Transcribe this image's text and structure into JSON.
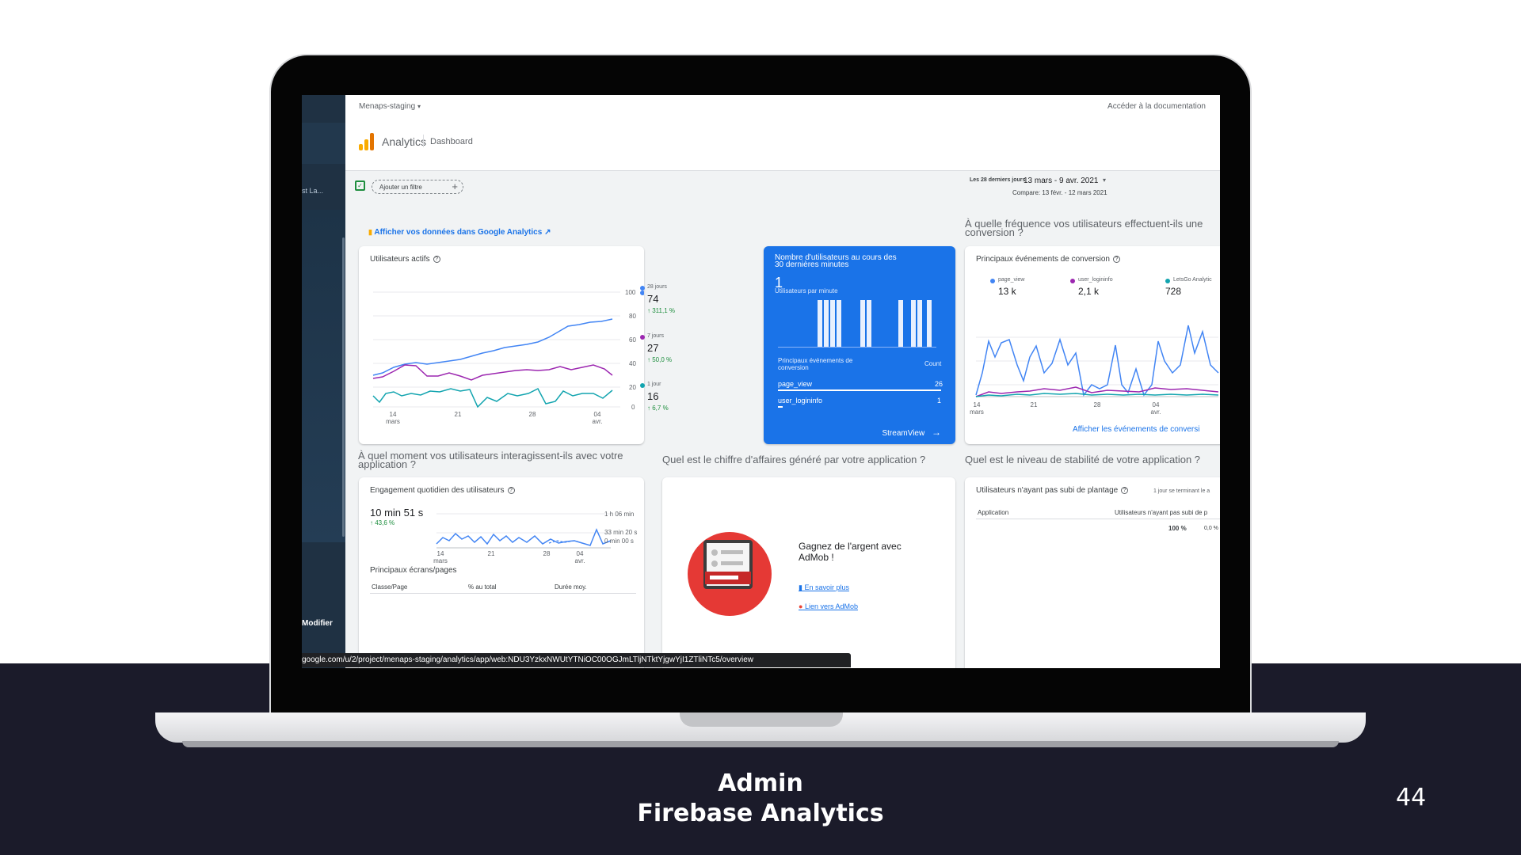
{
  "slide": {
    "title_line1": "Admin",
    "title_line2": "Firebase Analytics",
    "page_number": "44"
  },
  "colors": {
    "blue": "#4285f4",
    "purple": "#9c27b0",
    "teal": "#12a4af",
    "realtime_card": "#1a73e8",
    "footer": "#1b1b2a"
  },
  "sidebar": {
    "truncated_item": "st La...",
    "edit_label": "Modifier"
  },
  "topbar": {
    "project": "Menaps-staging",
    "project_icon": "chevron-down-icon",
    "docs_link": "Accéder à la documentation",
    "brand": "Analytics",
    "page": "Dashboard"
  },
  "filters": {
    "add_filter": "Ajouter un filtre",
    "add_icon": "plus-icon",
    "date_caption": "Les 28 derniers jours",
    "date_range": "13 mars - 9 avr. 2021",
    "compare": "Compare: 13 févr. - 12 mars 2021"
  },
  "ga_link": {
    "label": "Afficher vos données dans Google Analytics",
    "icon": "open-in-new-icon"
  },
  "questions": {
    "frequency": "À quelle fréquence vos utilisateurs effectuent-ils une conversion ?",
    "moment": "À quel moment vos utilisateurs interagissent-ils avec votre application ?",
    "revenue": "Quel est le chiffre d'affaires généré par votre application ?",
    "stability": "Quel est le niveau de stabilité de votre application ?"
  },
  "active_users": {
    "title": "Utilisateurs actifs",
    "y_ticks": [
      "100",
      "80",
      "60",
      "40",
      "20",
      "0"
    ],
    "x_ticks": [
      {
        "day": "14",
        "month": "mars"
      },
      {
        "day": "21",
        "month": ""
      },
      {
        "day": "28",
        "month": ""
      },
      {
        "day": "04",
        "month": "avr."
      }
    ],
    "legend": [
      {
        "label": "28 jours",
        "value": "74",
        "delta": "↑ 311,1 %"
      },
      {
        "label": "7 jours",
        "value": "27",
        "delta": "↑ 50,0 %"
      },
      {
        "label": "1 jour",
        "value": "16",
        "delta": "↑ 6,7 %"
      }
    ]
  },
  "realtime": {
    "title": "Nombre d'utilisateurs au cours des 30 dernières minutes",
    "count": "1",
    "subtitle": "Utilisateurs par minute",
    "events_header": "Principaux événements de conversion",
    "count_header": "Count",
    "rows": [
      {
        "name": "page_view",
        "count": "26"
      },
      {
        "name": "user_logininfo",
        "count": "1"
      }
    ],
    "stream_link": "StreamView",
    "stream_icon": "arrow-right-icon"
  },
  "conversions": {
    "title": "Principaux événements de conversion",
    "legend": [
      {
        "label": "page_view",
        "value": "13 k"
      },
      {
        "label": "user_logininfo",
        "value": "2,1 k"
      },
      {
        "label": "LetsGo Analytic",
        "value": "728"
      }
    ],
    "x_ticks": [
      {
        "day": "14",
        "month": "mars"
      },
      {
        "day": "21",
        "month": ""
      },
      {
        "day": "28",
        "month": ""
      },
      {
        "day": "04",
        "month": "avr."
      }
    ],
    "link": "Afficher les événements de conversi"
  },
  "engagement": {
    "title": "Engagement quotidien des utilisateurs",
    "value": "10 min 51 s",
    "delta": "↑ 43,6 %",
    "y_ticks": [
      "1 h 06 min",
      "33 min 20 s",
      "0 min 00 s"
    ],
    "x_ticks": [
      {
        "day": "14",
        "month": "mars"
      },
      {
        "day": "21",
        "month": ""
      },
      {
        "day": "28",
        "month": ""
      },
      {
        "day": "04",
        "month": "avr."
      }
    ],
    "screens_title": "Principaux écrans/pages",
    "columns": [
      "Classe/Page",
      "% au total",
      "Durée moy."
    ]
  },
  "admob": {
    "heading": "Gagnez de l'argent avec AdMob !",
    "learn_more": "En savoir plus",
    "learn_icon": "document-icon",
    "admob_link": "Lien vers AdMob",
    "admob_icon": "admob-icon"
  },
  "stability": {
    "title": "Utilisateurs n'ayant pas subi de plantage",
    "note": "1 jour se terminant le a",
    "columns": [
      "Application",
      "Utilisateurs n'ayant pas subi de p"
    ],
    "values": [
      "100 %",
      "0,0 %"
    ]
  },
  "status_url": "google.com/u/2/project/menaps-staging/analytics/app/web:NDU3YzkxNWUtYTNiOC00OGJmLTljNTktYjgwYjI1ZTliNTc5/overview"
}
